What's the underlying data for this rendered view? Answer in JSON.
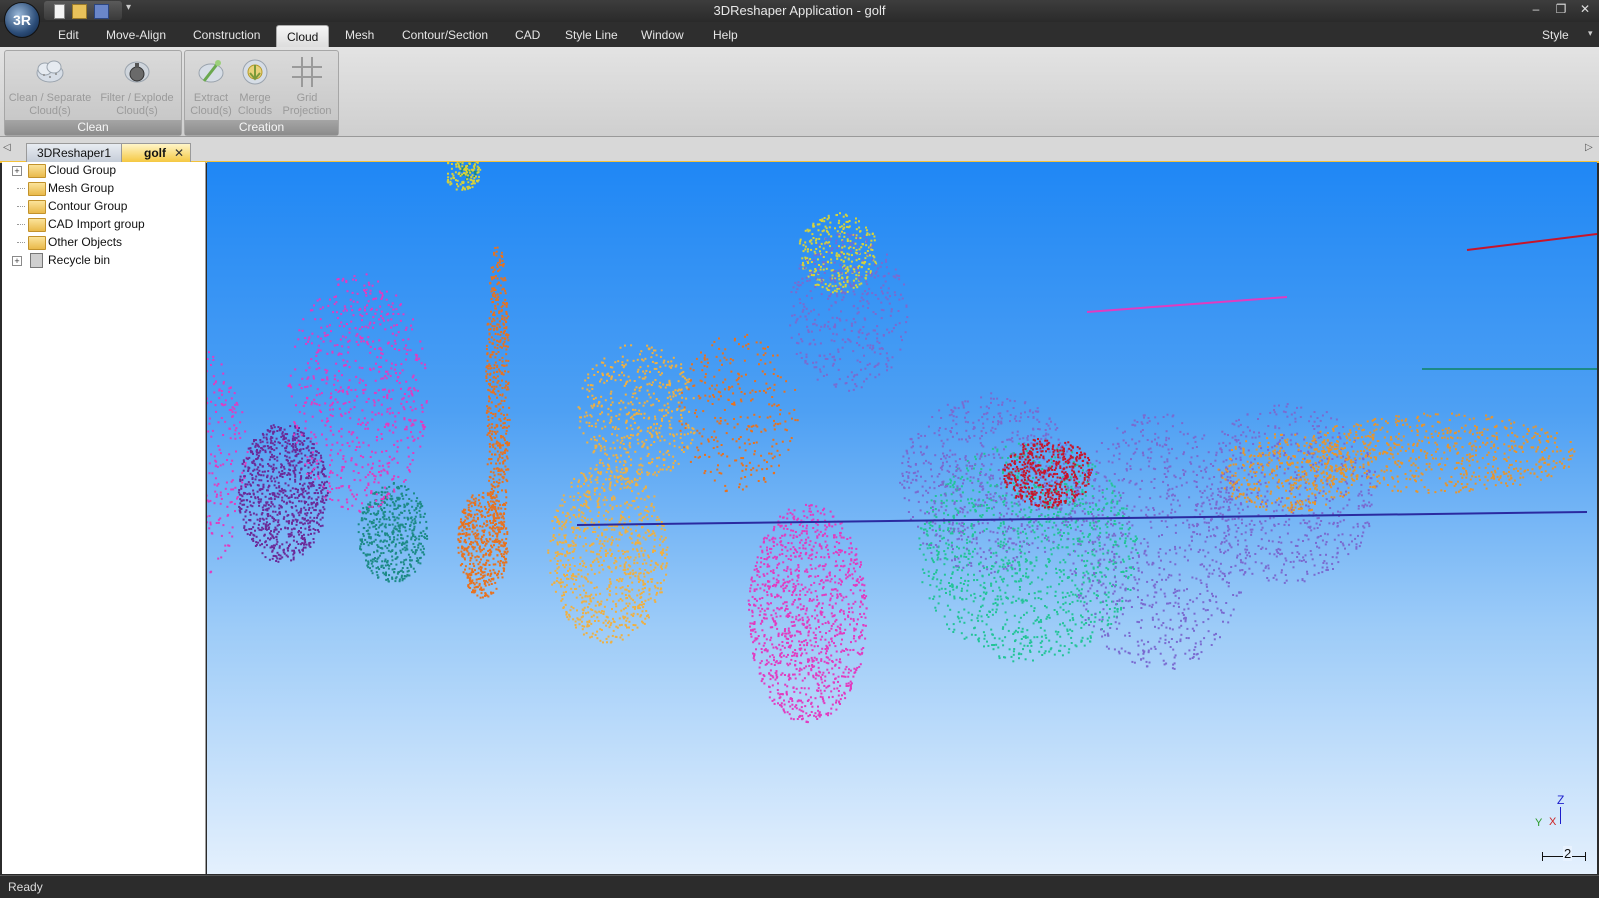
{
  "window": {
    "title": "3DReshaper Application - golf",
    "logo": "3R"
  },
  "quick_access": [
    "new-icon",
    "open-icon",
    "save-icon"
  ],
  "menu": {
    "tabs": [
      "Edit",
      "Move-Align",
      "Construction",
      "Cloud",
      "Mesh",
      "Contour/Section",
      "CAD",
      "Style Line",
      "Window",
      "Help"
    ],
    "active": "Cloud",
    "style_label": "Style"
  },
  "ribbon": {
    "groups": [
      {
        "title": "Clean",
        "buttons": [
          {
            "line1": "Clean / Separate",
            "line2": "Cloud(s)"
          },
          {
            "line1": "Filter / Explode",
            "line2": "Cloud(s)"
          }
        ]
      },
      {
        "title": "Creation",
        "buttons": [
          {
            "line1": "Extract",
            "line2": "Cloud(s)"
          },
          {
            "line1": "Merge",
            "line2": "Clouds"
          },
          {
            "line1": "Grid",
            "line2": "Projection"
          }
        ]
      }
    ]
  },
  "doc_tabs": [
    {
      "label": "3DReshaper1"
    },
    {
      "label": "golf",
      "active": true
    }
  ],
  "tree": [
    {
      "label": "Cloud Group",
      "expandable": true
    },
    {
      "label": "Mesh Group",
      "expandable": false
    },
    {
      "label": "Contour Group",
      "expandable": false
    },
    {
      "label": "CAD Import group",
      "expandable": false
    },
    {
      "label": "Other Objects",
      "expandable": false
    },
    {
      "label": "Recycle bin",
      "expandable": true
    }
  ],
  "viewport": {
    "axis": {
      "z": "Z",
      "y": "Y",
      "x": "X"
    },
    "scale_label": "2"
  },
  "status": {
    "text": "Ready"
  },
  "colors": {
    "sky_top": "#1f87f5",
    "sky_bottom": "#e4f0fd",
    "active_tab": "#f5c842",
    "point_cloud_palette": [
      "#e23bc0",
      "#6b2a98",
      "#1c8a86",
      "#e8721e",
      "#f0b040",
      "#22c497",
      "#c8142a",
      "#7a6ad0",
      "#e8952c",
      "#d7d23a"
    ]
  }
}
